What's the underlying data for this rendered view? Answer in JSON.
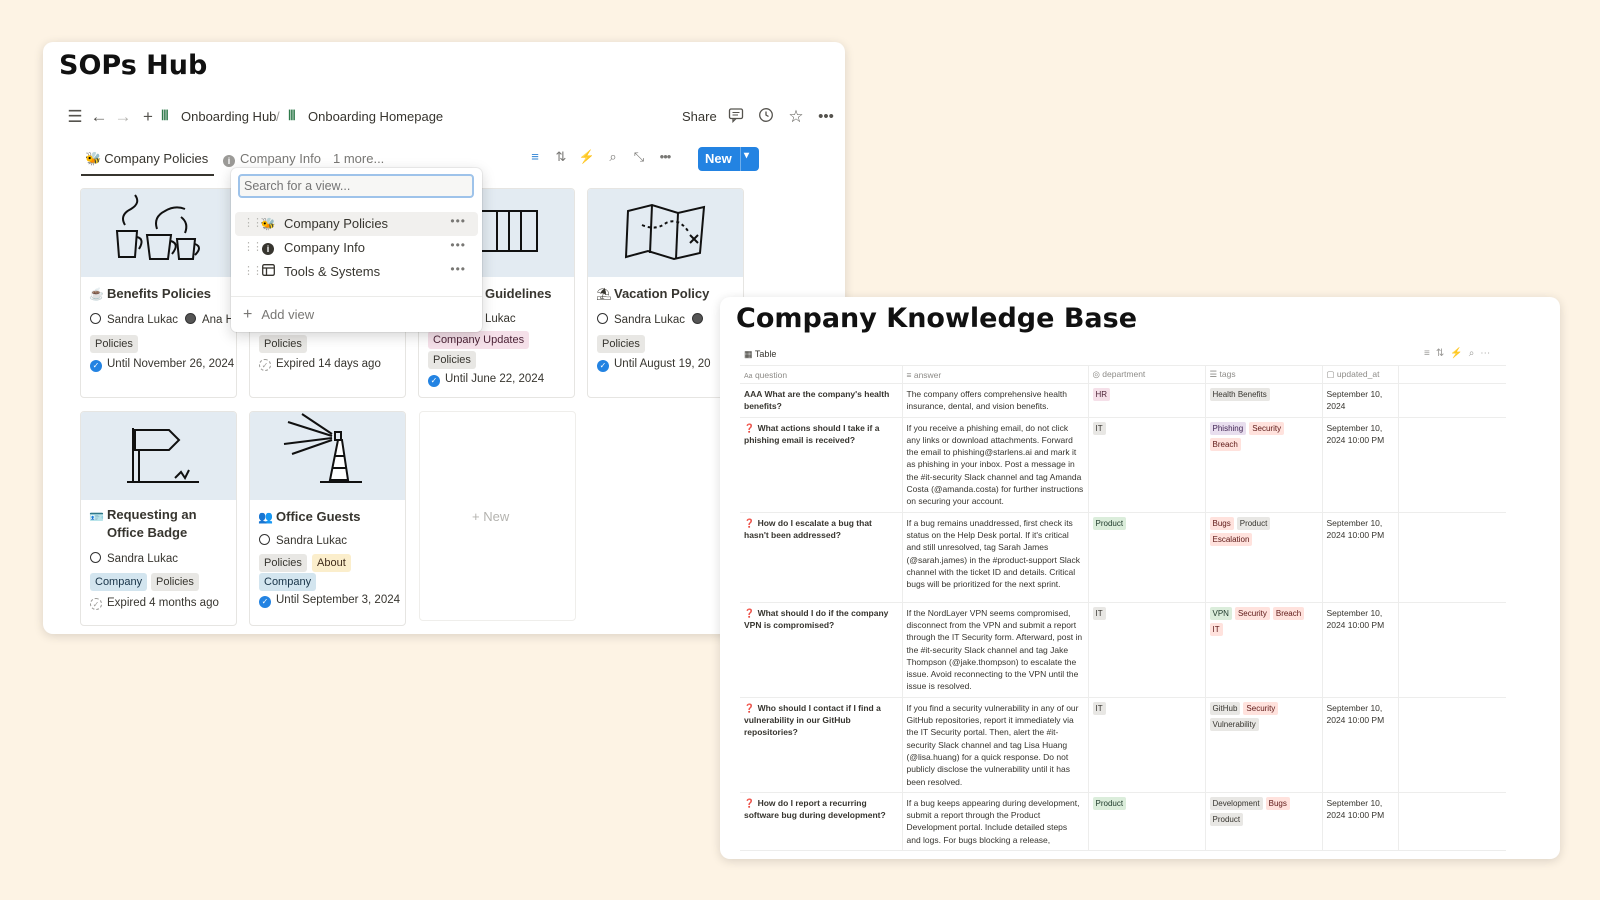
{
  "sops_hub": {
    "title": "SOPs Hub",
    "topbar": {
      "breadcrumb_1": "Onboarding Hub",
      "breadcrumb_sep": "/",
      "breadcrumb_2": "Onboarding Homepage",
      "share_label": "Share"
    },
    "tabs": [
      {
        "label": "Company Policies",
        "icon": "bee-icon",
        "active": true
      },
      {
        "label": "Company Info",
        "icon": "info-icon",
        "active": false
      },
      {
        "label": "1 more...",
        "active": false
      }
    ],
    "new_button_label": "New",
    "view_dropdown": {
      "search_placeholder": "Search for a view...",
      "items": [
        {
          "label": "Company Policies",
          "icon": "bee-icon"
        },
        {
          "label": "Company Info",
          "icon": "info-icon"
        },
        {
          "label": "Tools & Systems",
          "icon": "table-icon"
        }
      ],
      "add_view_label": "Add view"
    },
    "cards": [
      {
        "title": "Benefits Policies",
        "icon": "coffee-icon",
        "people": "Sandra Lukac",
        "people_2": "Ana Ha",
        "tags": [
          "Policies"
        ],
        "status": "Until November 26, 2024"
      },
      {
        "title": "",
        "people": "",
        "tags": [
          "Policies"
        ],
        "status": "Expired 14 days ago"
      },
      {
        "title": "Guidelines",
        "people": "Lukac",
        "tags": [
          "Company Updates",
          "Policies"
        ],
        "status": "Until June 22, 2024"
      },
      {
        "title": "Vacation Policy",
        "icon": "beach-icon",
        "people": "Sandra Lukac",
        "tags": [
          "Policies"
        ],
        "status": "Until August 19, 20"
      },
      {
        "title_line1": "Requesting an",
        "title_line2": "Office Badge",
        "icon": "badge-icon",
        "people": "Sandra Lukac",
        "tags": [
          "Company",
          "Policies"
        ],
        "status": "Expired 4 months ago"
      },
      {
        "title": "Office Guests",
        "icon": "people-icon",
        "people": "Sandra Lukac",
        "tags": [
          "Policies",
          "About",
          "Company"
        ],
        "status": "Until September 3, 2024"
      }
    ],
    "new_card_label": "+ New"
  },
  "knowledge_base": {
    "title": "Company Knowledge Base",
    "view_label": "Table",
    "columns": [
      "question",
      "answer",
      "department",
      "tags",
      "updated_at"
    ],
    "rows": [
      {
        "question": "AAA What are the company's health benefits?",
        "answer": "The company offers comprehensive health insurance, dental, and vision benefits.",
        "department": "HR",
        "tags": [
          "Health Benefits"
        ],
        "updated_at": "September 10, 2024"
      },
      {
        "question": "What actions should I take if a phishing email is received?",
        "answer": "If you receive a phishing email, do not click any links or download attachments. Forward the email to phishing@starlens.ai and mark it as phishing in your inbox. Post a message in the #it-security Slack channel and tag Amanda Costa (@amanda.costa) for further instructions on securing your account.",
        "department": "IT",
        "tags": [
          "Phishing",
          "Security",
          "Breach"
        ],
        "updated_at": "September 10, 2024 10:00 PM"
      },
      {
        "question": "How do I escalate a bug that hasn't been addressed?",
        "answer": "If a bug remains unaddressed, first check its status on the Help Desk portal. If it's critical and still unresolved, tag Sarah James (@sarah.james) in the #product-support Slack channel with the ticket ID and details. Critical bugs will be prioritized for the next sprint.",
        "department": "Product",
        "tags": [
          "Bugs",
          "Product",
          "Escalation"
        ],
        "updated_at": "September 10, 2024 10:00 PM"
      },
      {
        "question": "What should I do if the company VPN is compromised?",
        "answer": "If the NordLayer VPN seems compromised, disconnect from the VPN and submit a report through the IT Security form. Afterward, post in the #it-security Slack channel and tag Jake Thompson (@jake.thompson) to escalate the issue. Avoid reconnecting to the VPN until the issue is resolved.",
        "department": "IT",
        "tags": [
          "VPN",
          "Security",
          "Breach",
          "IT"
        ],
        "updated_at": "September 10, 2024 10:00 PM"
      },
      {
        "question": "Who should I contact if I find a vulnerability in our GitHub repositories?",
        "answer": "If you find a security vulnerability in any of our GitHub repositories, report it immediately via the IT Security portal. Then, alert the #it-security Slack channel and tag Lisa Huang (@lisa.huang) for a quick response. Do not publicly disclose the vulnerability until it has been resolved.",
        "department": "IT",
        "tags": [
          "GitHub",
          "Security",
          "Vulnerability"
        ],
        "updated_at": "September 10, 2024 10:00 PM"
      },
      {
        "question": "How do I report a recurring software bug during development?",
        "answer": "If a bug keeps appearing during development, submit a report through the Product Development portal. Include detailed steps and logs. For bugs blocking a release,",
        "department": "Product",
        "tags": [
          "Development",
          "Bugs",
          "Product"
        ],
        "updated_at": "September 10, 2024 10:00 PM"
      }
    ]
  },
  "colors": {
    "background": "#fdf3e4",
    "accent_blue": "#2383e2",
    "cover": "#e3ebf2"
  }
}
